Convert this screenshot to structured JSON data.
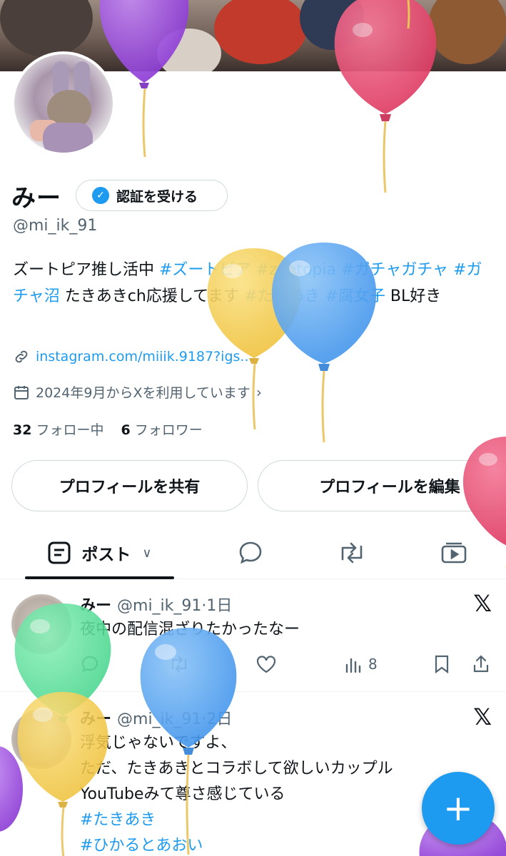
{
  "profile": {
    "name": "みー",
    "verify_label": "認証を受ける",
    "handle": "@mi_ik_91",
    "bio_parts": [
      {
        "text": "ズートピア推し活中 ",
        "tag": false
      },
      {
        "text": "#ズートピア",
        "tag": true
      },
      {
        "text": " ",
        "tag": false
      },
      {
        "text": "#zootopia",
        "tag": true
      },
      {
        "text": " ",
        "tag": false
      },
      {
        "text": "#ガチャガチャ",
        "tag": true
      },
      {
        "text": " ",
        "tag": false
      },
      {
        "text": "#ガチャ沼",
        "tag": true
      },
      {
        "text": " たきあきch応援してます ",
        "tag": false
      },
      {
        "text": "#たきあき",
        "tag": true
      },
      {
        "text": " ",
        "tag": false
      },
      {
        "text": "#腐女子",
        "tag": true
      },
      {
        "text": " BL好き",
        "tag": false
      }
    ],
    "link": "instagram.com/miiik.9187?igs...",
    "joined": "2024年9月からXを利用しています",
    "following_count": "32",
    "following_label": "フォロー中",
    "followers_count": "6",
    "followers_label": "フォロワー",
    "share_button": "プロフィールを共有",
    "edit_button": "プロフィールを編集"
  },
  "tabs": {
    "posts_label": "ポスト"
  },
  "posts": [
    {
      "name": "みー",
      "meta": "@mi_ik_91·1日",
      "lines": [
        "夜中の配信混ざりたかったなー"
      ],
      "tags": [],
      "views": "8"
    },
    {
      "name": "みー",
      "meta": "@mi_ik_91·2日",
      "lines": [
        "浮気じゃないですよ、",
        "ただ、たきあきとコラボして欲しいカップル",
        "YouTubeみて尊さ感じている"
      ],
      "tags": [
        "#たきあき",
        "#ひかるとあおい"
      ]
    }
  ],
  "fab_label": "+",
  "colors": {
    "accent": "#1d9bf0",
    "text": "#0f1419",
    "secondary": "#536471",
    "balloon_purple": "#9b4de0",
    "balloon_red": "#e8476f",
    "balloon_yellow": "#f4cc45",
    "balloon_blue": "#4b9ef0",
    "balloon_green": "#4fdc95"
  }
}
